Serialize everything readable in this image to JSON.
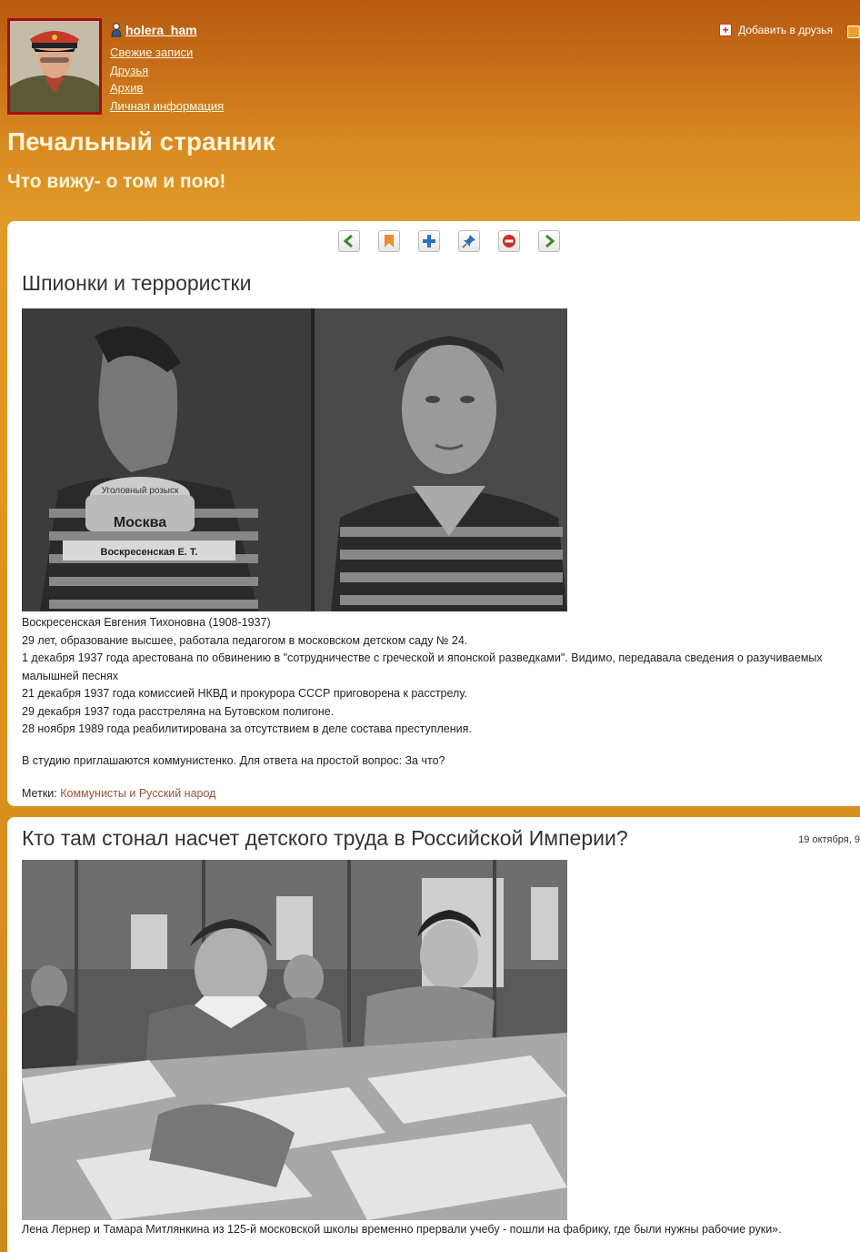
{
  "header": {
    "username": "holera_ham",
    "nav": [
      "Свежие записи",
      "Друзья",
      "Архив",
      "Личная информация"
    ],
    "add_friend": "Добавить в друзья",
    "journal_title": "Печальный странник",
    "journal_subtitle": "Что вижу- о том и пою!"
  },
  "toolbar": {
    "icons": [
      "arrow-left-icon",
      "bookmark-icon",
      "add-icon",
      "pin-icon",
      "remove-icon",
      "arrow-right-icon"
    ]
  },
  "post1": {
    "title": "Шпионки и террористки",
    "photo_sign_1": "Уголовный розыск",
    "photo_sign_2": "Москва",
    "photo_sign_3": "Воскресенская Е. Т.",
    "lines": [
      "Воскресенская Евгения Тихоновна (1908-1937)",
      "29 лет, образование высшее, работала педагогом в московском детском саду № 24.",
      "1 декабря 1937 года арестована по обвинению в \"сотрудничестве с греческой и японской разведками\". Видимо, передавала сведения о разучиваемых малышней песнях",
      "21 декабря 1937 года комиссией НКВД и прокурора СССР приговорена к расстрелу.",
      "29 декабря 1937 года расстреляна на Бутовском полигоне.",
      "28 ноября 1989 года реабилитирована за отсутствием в деле состава преступления."
    ],
    "question": "В студию приглашаются коммунистенко. Для ответа на простой вопрос: За что?",
    "tags_label": "Метки:",
    "tags_value": "Коммунисты и Русский народ"
  },
  "post2": {
    "title": "Кто там стонал насчет детского труда в Российской Империи?",
    "date": "19 октября, 9",
    "caption": "Лена Лернер и Тамара Митлянкина из 125-й московской школы временно прервали учебу - пошли на фабрику, где были нужны рабочие руки»."
  },
  "colors": {
    "header_orange": "#d98a22",
    "link_tag": "#a0503a",
    "avatar_border": "#a01010"
  }
}
